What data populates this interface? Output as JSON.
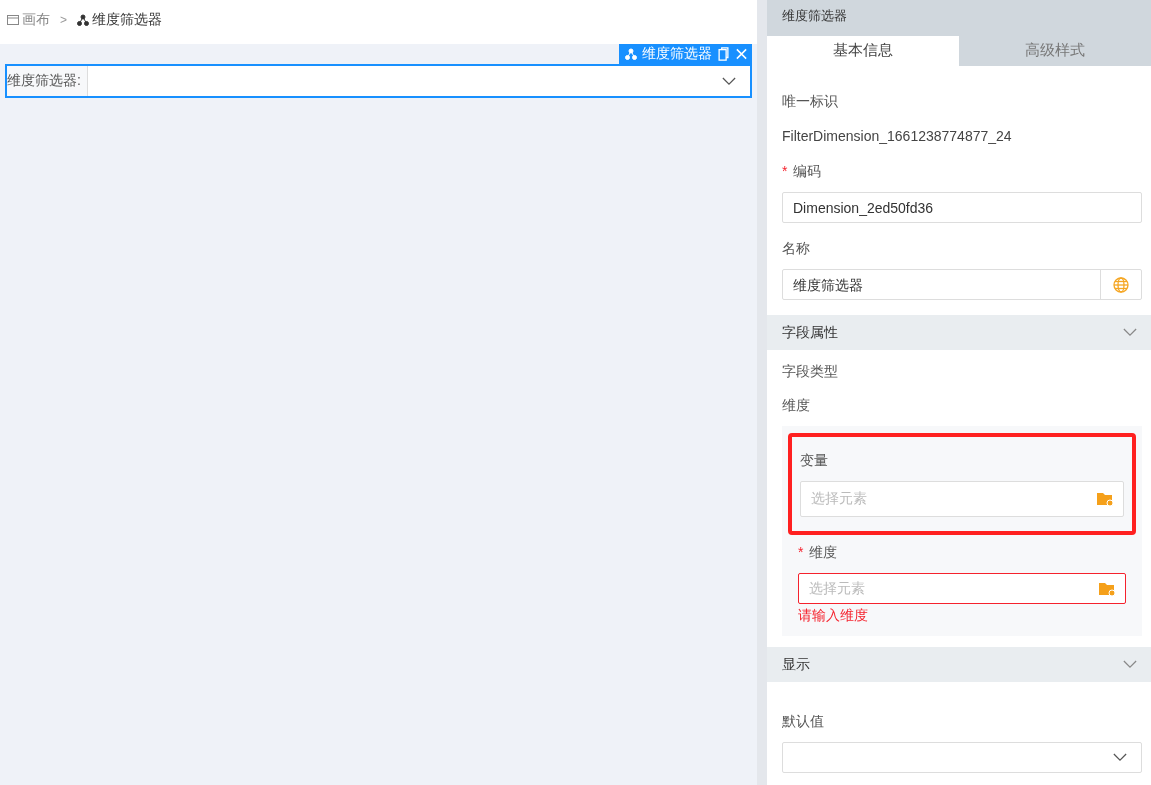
{
  "breadcrumb": [
    {
      "label": "画布",
      "kind": "canvas"
    },
    {
      "label": "维度筛选器",
      "kind": "component"
    }
  ],
  "breadcrumb_separator": ">",
  "canvas": {
    "widget_tag": {
      "label": "维度筛选器"
    },
    "widget": {
      "label": "维度筛选器:",
      "selected": true
    }
  },
  "panel": {
    "title": "维度筛选器",
    "tabs": [
      {
        "label": "基本信息",
        "selected": true
      },
      {
        "label": "高级样式",
        "selected": false
      }
    ],
    "fields": [
      {
        "kind": "text",
        "label": "唯一标识",
        "value": "FilterDimension_1661238774877_24"
      },
      {
        "kind": "input",
        "label": "编码",
        "required_mark": "*",
        "value": "Dimension_2ed50fd36"
      },
      {
        "kind": "input-globe",
        "label": "名称",
        "value": "维度筛选器"
      }
    ],
    "sections": [
      {
        "title": "字段属性",
        "expanded": true,
        "type_label": "字段类型",
        "type_value": "维度",
        "pickers": [
          {
            "label": "变量",
            "placeholder": "选择元素",
            "highlighted": true
          },
          {
            "label": "维度",
            "required_mark": "*",
            "placeholder": "选择元素",
            "error": "请输入维度"
          }
        ]
      },
      {
        "title": "显示",
        "expanded": true,
        "default_label": "默认值"
      }
    ]
  }
}
